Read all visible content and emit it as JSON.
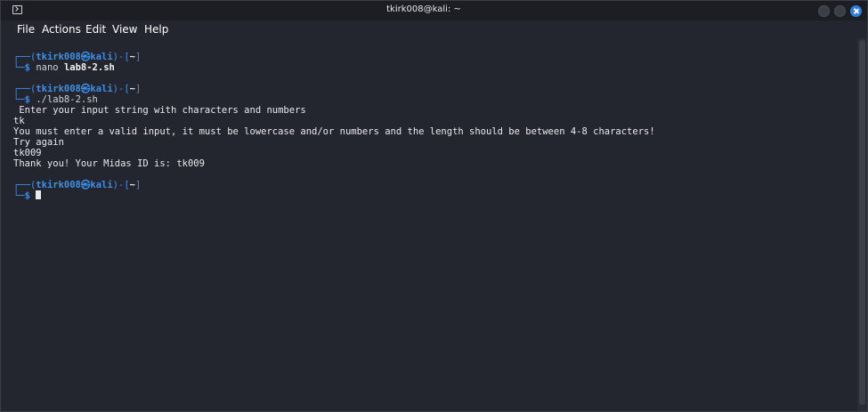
{
  "window": {
    "title": "tkirk008@kali: ~"
  },
  "menu": {
    "file": "File",
    "actions": "Actions",
    "edit": "Edit",
    "view": "View",
    "help": "Help"
  },
  "prompt": {
    "top_left": "┌──(",
    "user": "tkirk008",
    "at_icon": "㉿",
    "host": "kali",
    "sep": ")-[",
    "dir": "~",
    "close": "]",
    "bottom_left": "└─",
    "dollar": "$"
  },
  "commands": [
    {
      "name": "nano",
      "arg": "lab8-2.sh"
    },
    {
      "name": "./lab8-2.sh"
    }
  ],
  "output": [
    " Enter your input string with characters and numbers",
    "tk",
    "You must enter a valid input, it must be lowercase and/or numbers and the length should be between 4-8 characters!",
    "Try again",
    "tk009",
    "Thank you! Your Midas ID is: tk009"
  ],
  "colors": {
    "background": "#23262e",
    "prompt_blue": "#3f8fe8",
    "text": "#e8eaee",
    "close_button": "#2f7fe0"
  }
}
